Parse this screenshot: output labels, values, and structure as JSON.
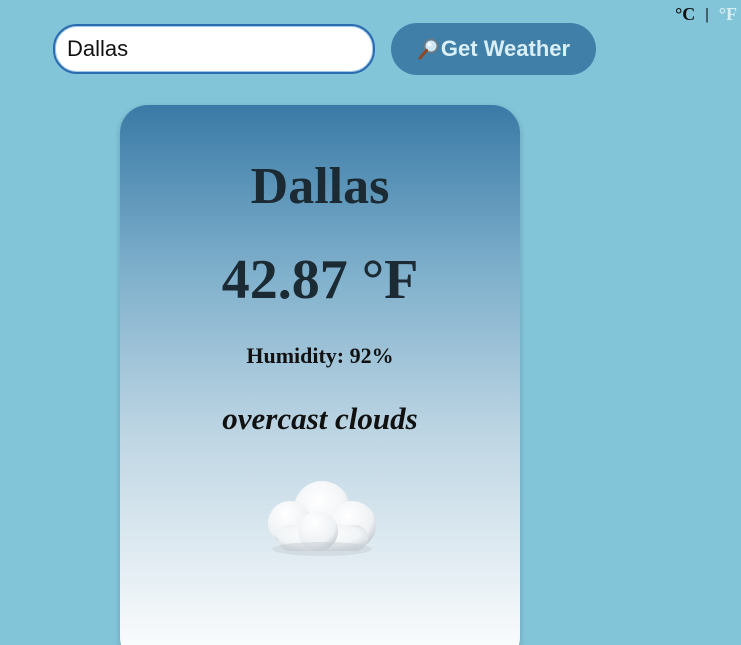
{
  "units": {
    "celsius_label": "°C",
    "separator": "|",
    "fahrenheit_label": "°F",
    "active": "celsius"
  },
  "search": {
    "value": "Dallas",
    "button_label": "Get Weather",
    "button_icon": "magnifying-glass-icon"
  },
  "weather": {
    "city": "Dallas",
    "temperature": "42.87 °F",
    "humidity": "Humidity: 92%",
    "description": "overcast clouds",
    "icon": "cloud-icon"
  },
  "colors": {
    "background": "#82c4d8",
    "button": "#3f7fa8",
    "card_top": "#3a7aa6",
    "card_bottom": "#ffffff"
  }
}
